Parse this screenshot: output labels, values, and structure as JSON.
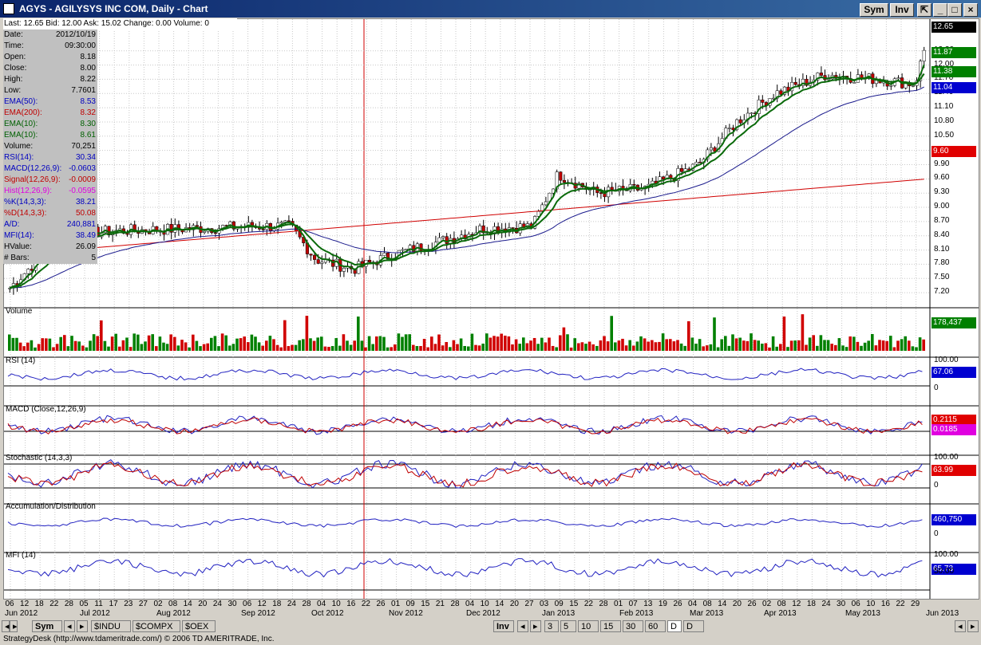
{
  "window": {
    "title": "AGYS - AGILYSYS INC COM, Daily - Chart",
    "sym_label": "Sym",
    "inv_label": "Inv"
  },
  "quote_bar": {
    "last": "Last: 12.65",
    "bid": "Bid: 12.00",
    "ask": "Ask: 15.02",
    "change": "Change: 0.00",
    "volume": "Volume: 0"
  },
  "info_panel": [
    {
      "label": "Date:",
      "value": "2012/10/19",
      "color": "#000000"
    },
    {
      "label": "Time:",
      "value": "09:30:00",
      "color": "#000000"
    },
    {
      "label": "Open:",
      "value": "8.18",
      "color": "#000000"
    },
    {
      "label": "Close:",
      "value": "8.00",
      "color": "#000000"
    },
    {
      "label": "High:",
      "value": "8.22",
      "color": "#000000"
    },
    {
      "label": "Low:",
      "value": "7.7601",
      "color": "#000000"
    },
    {
      "label": "EMA(50):",
      "value": "8.53",
      "color": "#0000c0"
    },
    {
      "label": "EMA(200):",
      "value": "8.32",
      "color": "#c00000"
    },
    {
      "label": "EMA(10):",
      "value": "8.30",
      "color": "#006000"
    },
    {
      "label": "EMA(10):",
      "value": "8.61",
      "color": "#006000"
    },
    {
      "label": "Volume:",
      "value": "70,251",
      "color": "#000000"
    },
    {
      "label": "RSI(14):",
      "value": "30.34",
      "color": "#0000c0"
    },
    {
      "label": "MACD(12,26,9):",
      "value": "-0.0603",
      "color": "#0000c0"
    },
    {
      "label": "Signal(12,26,9):",
      "value": "-0.0009",
      "color": "#c00000"
    },
    {
      "label": "Hist(12,26,9):",
      "value": "-0.0595",
      "color": "#e000e0"
    },
    {
      "label": "%K(14,3,3):",
      "value": "38.21",
      "color": "#0000c0"
    },
    {
      "label": "%D(14,3,3):",
      "value": "50.08",
      "color": "#c00000"
    },
    {
      "label": "A/D:",
      "value": "240,881",
      "color": "#0000c0"
    },
    {
      "label": "MFI(14):",
      "value": "38.49",
      "color": "#0000c0"
    },
    {
      "label": "HValue:",
      "value": "26.09",
      "color": "#000000"
    },
    {
      "label": "# Bars:",
      "value": "5",
      "color": "#000000"
    }
  ],
  "price_axis": [
    "12.30",
    "12.00",
    "11.70",
    "11.40",
    "11.10",
    "10.80",
    "10.50",
    "10.20",
    "9.90",
    "9.60",
    "9.30",
    "9.00",
    "8.70",
    "8.40",
    "8.10",
    "7.80",
    "7.50",
    "7.20"
  ],
  "price_tags": [
    {
      "text": "12.65",
      "color": "#000000"
    },
    {
      "text": "11.87",
      "color": "#008000"
    },
    {
      "text": "11.38",
      "color": "#008000"
    },
    {
      "text": "11.04",
      "color": "#0000d0"
    },
    {
      "text": "9.60",
      "color": "#e00000"
    }
  ],
  "panels": [
    {
      "label": "Volume",
      "tag": "178,437",
      "tag_color": "#008000",
      "top": "",
      "bottom": ""
    },
    {
      "label": "RSI (14)",
      "tag": "67.06",
      "tag_color": "#0000d0",
      "top": "100.00",
      "bottom": "0"
    },
    {
      "label": "MACD (Close,12,26,9)",
      "tag": "0.2115",
      "tag_color": "#e00000",
      "tag2": "0.0185",
      "tag2_color": "#e000e0"
    },
    {
      "label": "Stochastic (14,3,3)",
      "tag": "63.99",
      "tag_color": "#e00000",
      "top": "100.00",
      "bottom": "0"
    },
    {
      "label": "Accumulation/Distribution",
      "tag": "460,750",
      "tag_color": "#0000d0",
      "bottom": "0"
    },
    {
      "label": "MFI (14)",
      "tag": "65.73",
      "tag_color": "#0000d0",
      "top": "100.00",
      "mid": "50.00"
    }
  ],
  "x_days": [
    "06",
    "12",
    "18",
    "22",
    "28",
    "05",
    "11",
    "17",
    "23",
    "27",
    "02",
    "08",
    "14",
    "20",
    "24",
    "30",
    "06",
    "12",
    "18",
    "24",
    "28",
    "04",
    "10",
    "16",
    "22",
    "26",
    "01",
    "09",
    "15",
    "21",
    "28",
    "04",
    "10",
    "14",
    "20",
    "27",
    "03",
    "09",
    "15",
    "22",
    "28",
    "01",
    "07",
    "13",
    "19",
    "26",
    "04",
    "08",
    "14",
    "20",
    "26",
    "02",
    "08",
    "12",
    "18",
    "24",
    "30",
    "06",
    "10",
    "16",
    "22",
    "29"
  ],
  "x_months": [
    {
      "text": "Jun 2012"
    },
    {
      "text": "Jul 2012"
    },
    {
      "text": "Aug 2012"
    },
    {
      "text": "Sep 2012"
    },
    {
      "text": "Oct 2012"
    },
    {
      "text": "Nov 2012"
    },
    {
      "text": "Dec 2012"
    },
    {
      "text": "Jan 2013"
    },
    {
      "text": "Feb 2013"
    },
    {
      "text": "Mar 2013"
    },
    {
      "text": "Apr 2013"
    },
    {
      "text": "May 2013"
    },
    {
      "text": "Jun 2013"
    }
  ],
  "tabs_left": [
    "Sym",
    "$INDU",
    "$COMPX",
    "$OEX"
  ],
  "tabs_right": [
    "Inv",
    "3",
    "5",
    "10",
    "15",
    "30",
    "60",
    "D",
    "D"
  ],
  "status": "StrategyDesk (http://www.tdameritrade.com/) © 2006 TD AMERITRADE, Inc."
}
